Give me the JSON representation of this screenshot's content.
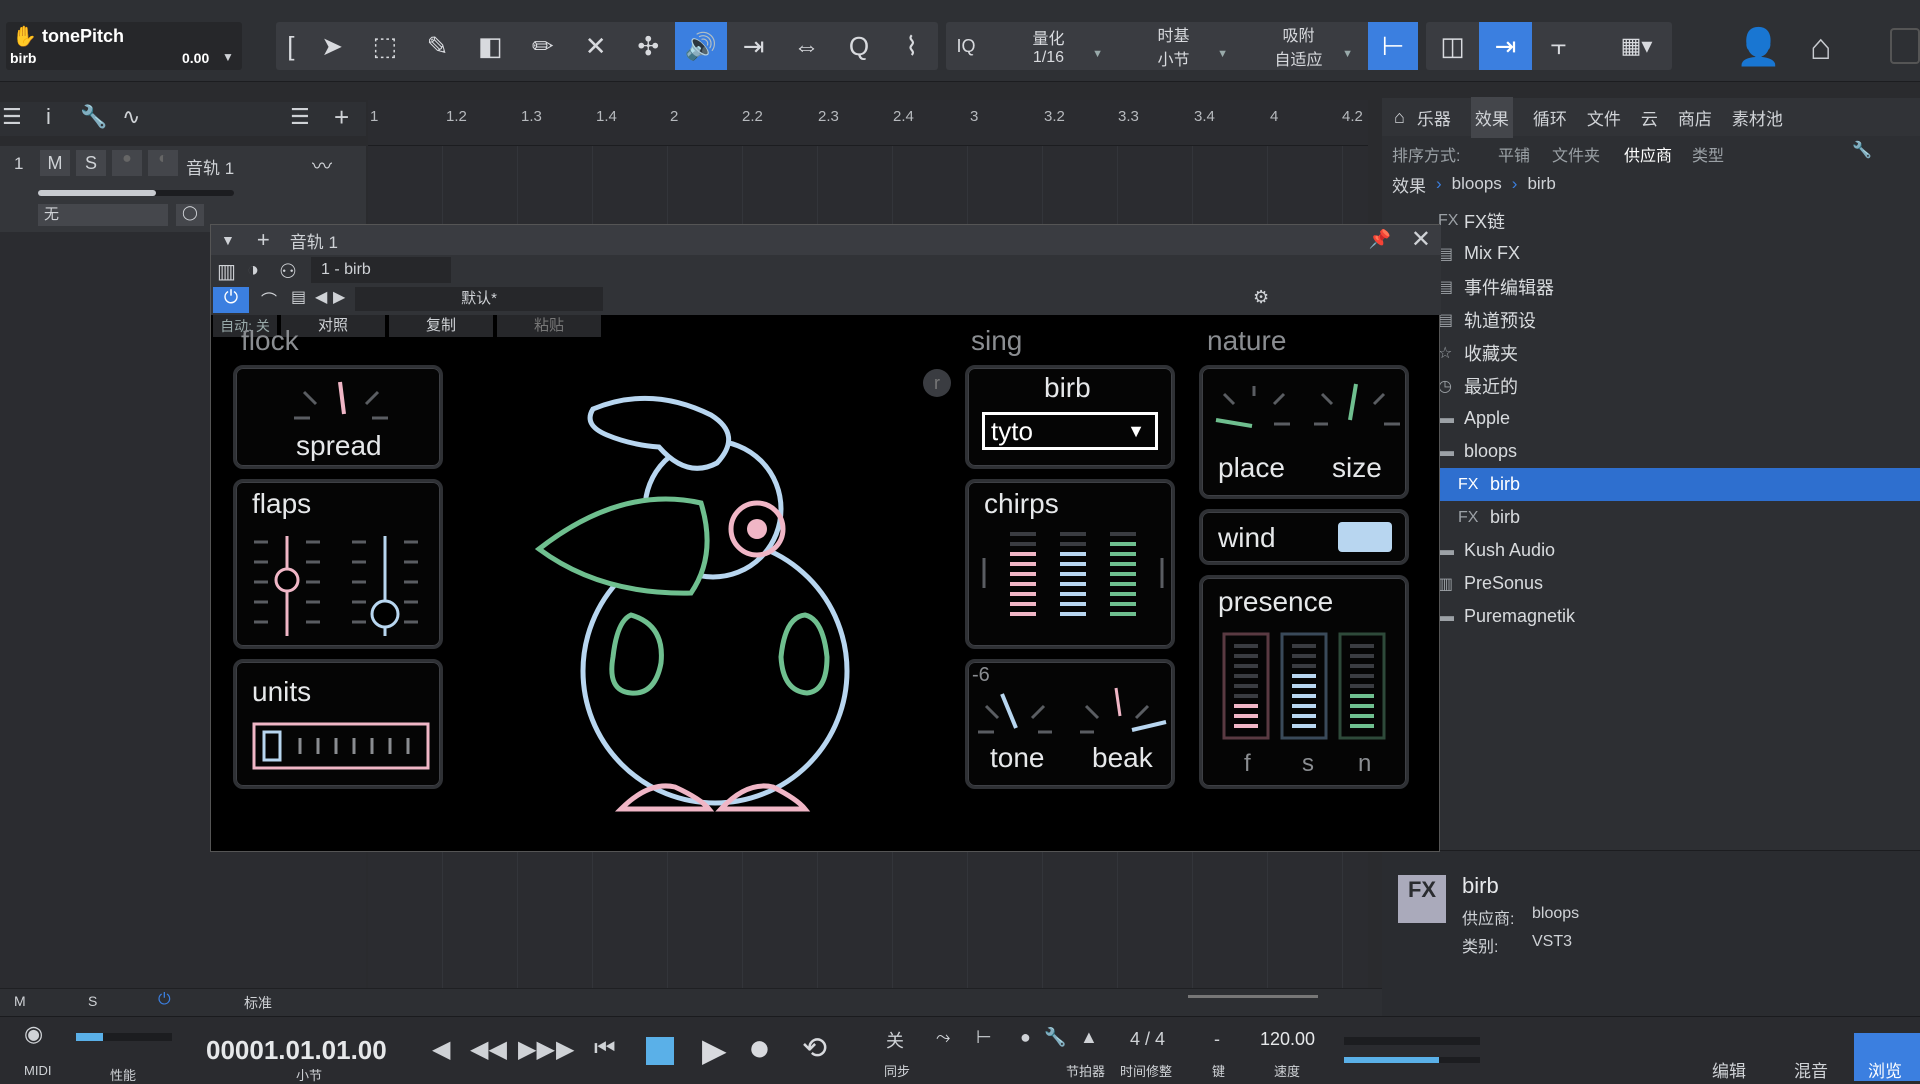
{
  "song": {
    "title": "tonePitch",
    "track": "birb",
    "value": "0.00"
  },
  "toolbar": {
    "iq": "IQ",
    "quant_label": "量化",
    "quant_value": "1/16",
    "timebase_label": "时基",
    "timebase_value": "小节",
    "snap_label": "吸附",
    "snap_value": "自适应"
  },
  "track": {
    "number": "1",
    "m": "M",
    "s": "S",
    "name": "音轨 1",
    "input": "无"
  },
  "ruler": [
    "1",
    "1.2",
    "1.3",
    "1.4",
    "2",
    "2.2",
    "2.3",
    "2.4",
    "3",
    "3.2",
    "3.3",
    "3.4",
    "4",
    "4.2"
  ],
  "browser": {
    "tabs": [
      "乐器",
      "效果",
      "循环",
      "文件",
      "云",
      "商店",
      "素材池"
    ],
    "active_tab": "效果",
    "sort_label": "排序方式:",
    "sort_opts": [
      "平铺",
      "文件夹",
      "供应商",
      "类型"
    ],
    "sort_active": "供应商",
    "crumb": [
      "效果",
      "bloops",
      "birb"
    ],
    "items": [
      {
        "label": "FX链",
        "icon": "FX"
      },
      {
        "label": "Mix FX",
        "icon": "▤"
      },
      {
        "label": "事件编辑器",
        "icon": "▤"
      },
      {
        "label": "轨道预设",
        "icon": "▤"
      },
      {
        "label": "收藏夹",
        "icon": "☆"
      },
      {
        "label": "最近的",
        "icon": "◷"
      },
      {
        "label": "Apple",
        "icon": "▬"
      },
      {
        "label": "bloops",
        "icon": "▬"
      },
      {
        "label": "birb",
        "icon": "FX"
      },
      {
        "label": "birb",
        "icon": "FX"
      },
      {
        "label": "Kush Audio",
        "icon": "▬"
      },
      {
        "label": "PreSonus",
        "icon": "▥"
      },
      {
        "label": "Puremagnetik",
        "icon": "▬"
      }
    ],
    "info_name": "birb",
    "info_vendor_label": "供应商:",
    "info_vendor": "bloops",
    "info_type_label": "类别:",
    "info_type": "VST3"
  },
  "plugin": {
    "track": "音轨 1",
    "slot": "1 - birb",
    "preset": "默认*",
    "auto": "自动: 关",
    "compare": "对照",
    "copy": "复制",
    "paste": "粘贴",
    "sections": {
      "flock": "flock",
      "sing": "sing",
      "nature": "nature"
    },
    "labels": {
      "spread": "spread",
      "flaps": "flaps",
      "units": "units",
      "birb": "birb",
      "type": "tyto",
      "chirps": "chirps",
      "tone": "tone",
      "beak": "beak",
      "tone_value": "-6",
      "place": "place",
      "size": "size",
      "wind": "wind",
      "presence": "presence",
      "f": "f",
      "s": "s",
      "n": "n",
      "r": "r"
    }
  },
  "bottom": {
    "m": "M",
    "s": "S",
    "mode": "标准"
  },
  "transport": {
    "midi": "MIDI",
    "perf": "性能",
    "time": "00001.01.01.00",
    "unit": "小节",
    "off": "关",
    "sync": "同步",
    "metro": "节拍器",
    "sig": "4 / 4",
    "timefix": "时间修整",
    "key": "-",
    "key_label": "键",
    "tempo": "120.00",
    "tempo_label": "速度",
    "edit": "编辑",
    "mix": "混音",
    "browse": "浏览"
  }
}
